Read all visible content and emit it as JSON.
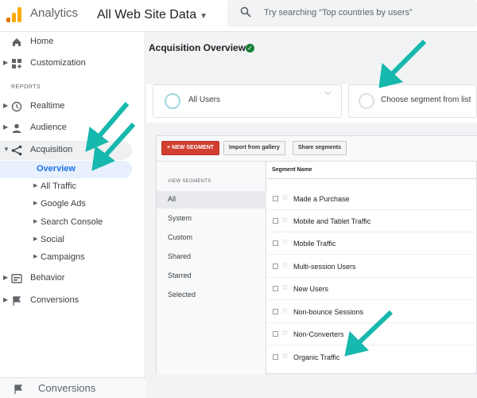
{
  "header": {
    "app_name": "Analytics",
    "property": "All Web Site Data",
    "search_placeholder": "Try searching “Top countries by users”"
  },
  "colors": {
    "brand_orange": "#f9ab00",
    "brand_dark_orange": "#e37400",
    "arrow_teal": "#17b8ad",
    "selected_blue": "#1a73e8"
  },
  "sidebar": {
    "home": "Home",
    "customization": "Customization",
    "reports_heading": "REPORTS",
    "realtime": "Realtime",
    "audience": "Audience",
    "acquisition": "Acquisition",
    "acquisition_children": [
      "Overview",
      "All Traffic",
      "Google Ads",
      "Search Console",
      "Social",
      "Campaigns"
    ],
    "behavior": "Behavior",
    "conversions": "Conversions",
    "bottom_conversions": "Conversions"
  },
  "main": {
    "page_title": "Acquisition Overview",
    "segments": {
      "active": "All Users",
      "choose": "Choose segment from list"
    },
    "toolbar": {
      "new_segment": "+ NEW SEGMENT",
      "import": "Import from gallery",
      "share": "Share segments"
    },
    "view_segments": {
      "heading": "VIEW SEGMENTS",
      "items": [
        "All",
        "System",
        "Custom",
        "Shared",
        "Starred",
        "Selected"
      ],
      "selected": "All"
    },
    "segment_list": {
      "header": "Segment Name",
      "rows": [
        "Made a Purchase",
        "Mobile and Tablet Traffic",
        "Mobile Traffic",
        "Multi-session Users",
        "New Users",
        "Non-bounce Sessions",
        "Non-Converters",
        "Organic Traffic"
      ]
    }
  }
}
